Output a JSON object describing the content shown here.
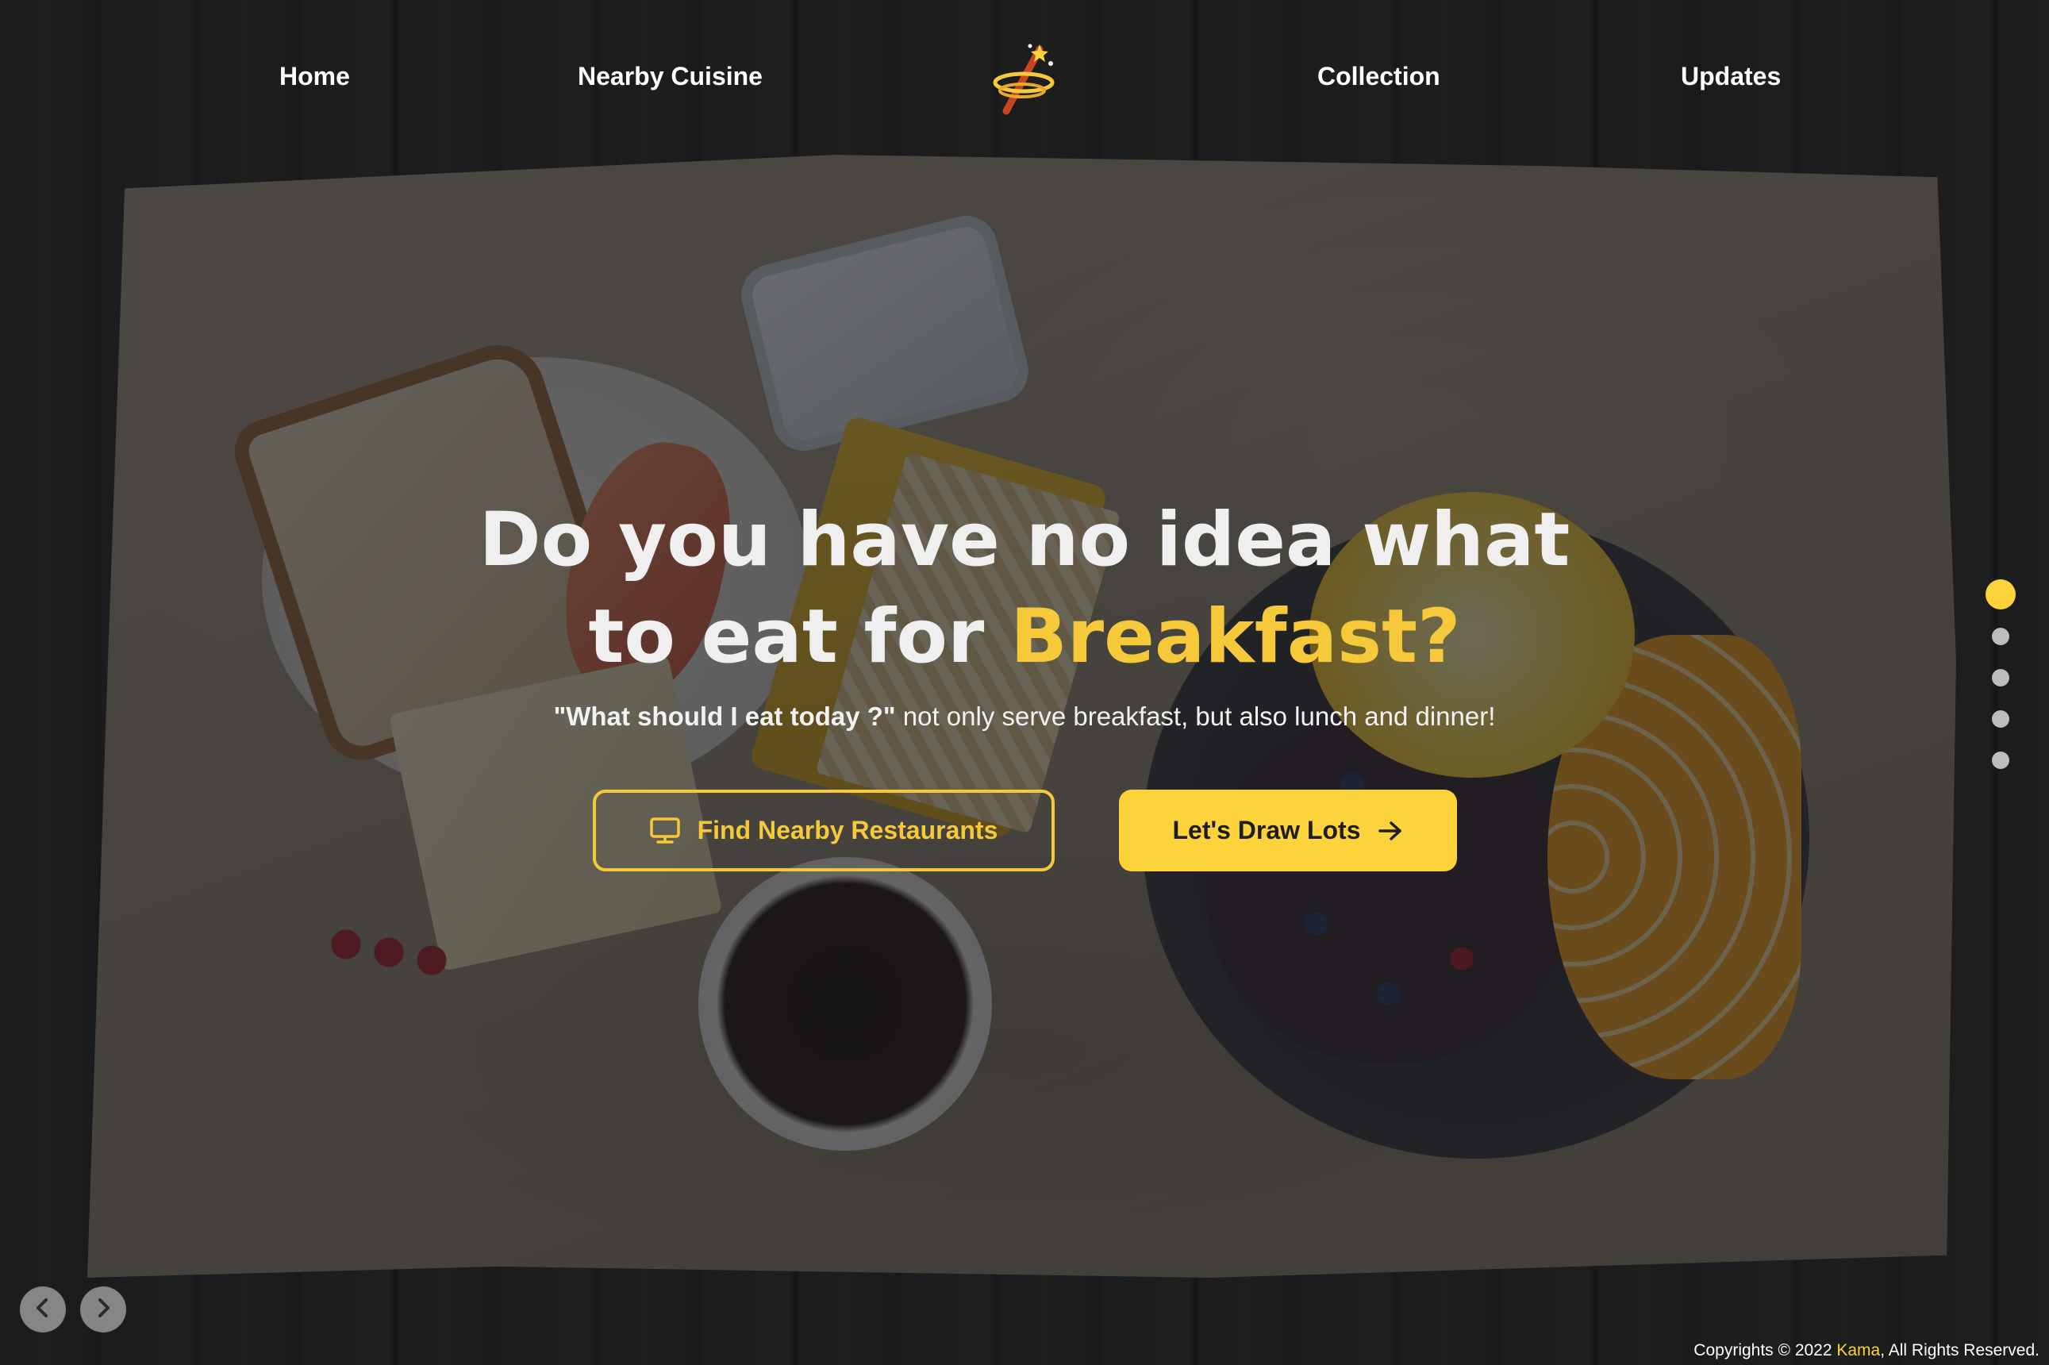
{
  "nav": {
    "home": "Home",
    "nearby_cuisine": "Nearby Cuisine",
    "collection": "Collection",
    "updates": "Updates"
  },
  "hero": {
    "line1": "Do you have no idea what",
    "line2_prefix": "to eat for ",
    "line2_accent": "Breakfast?",
    "sub_quote": "\"What should I eat today ?\"",
    "sub_rest": " not only serve breakfast, but also lunch and dinner!"
  },
  "buttons": {
    "find_label": "Find Nearby Restaurants",
    "find_icon": "monitor-icon",
    "draw_label": "Let's Draw Lots",
    "draw_icon": "arrow-right-icon"
  },
  "pager": {
    "total": 5,
    "active_index": 0
  },
  "footer": {
    "prefix": "Copyrights © 2022 ",
    "brand": "Kama",
    "suffix": ", All Rights Reserved."
  },
  "colors": {
    "accent": "#fcd33a",
    "headline": "#efefef",
    "background": "#1c1f24"
  }
}
